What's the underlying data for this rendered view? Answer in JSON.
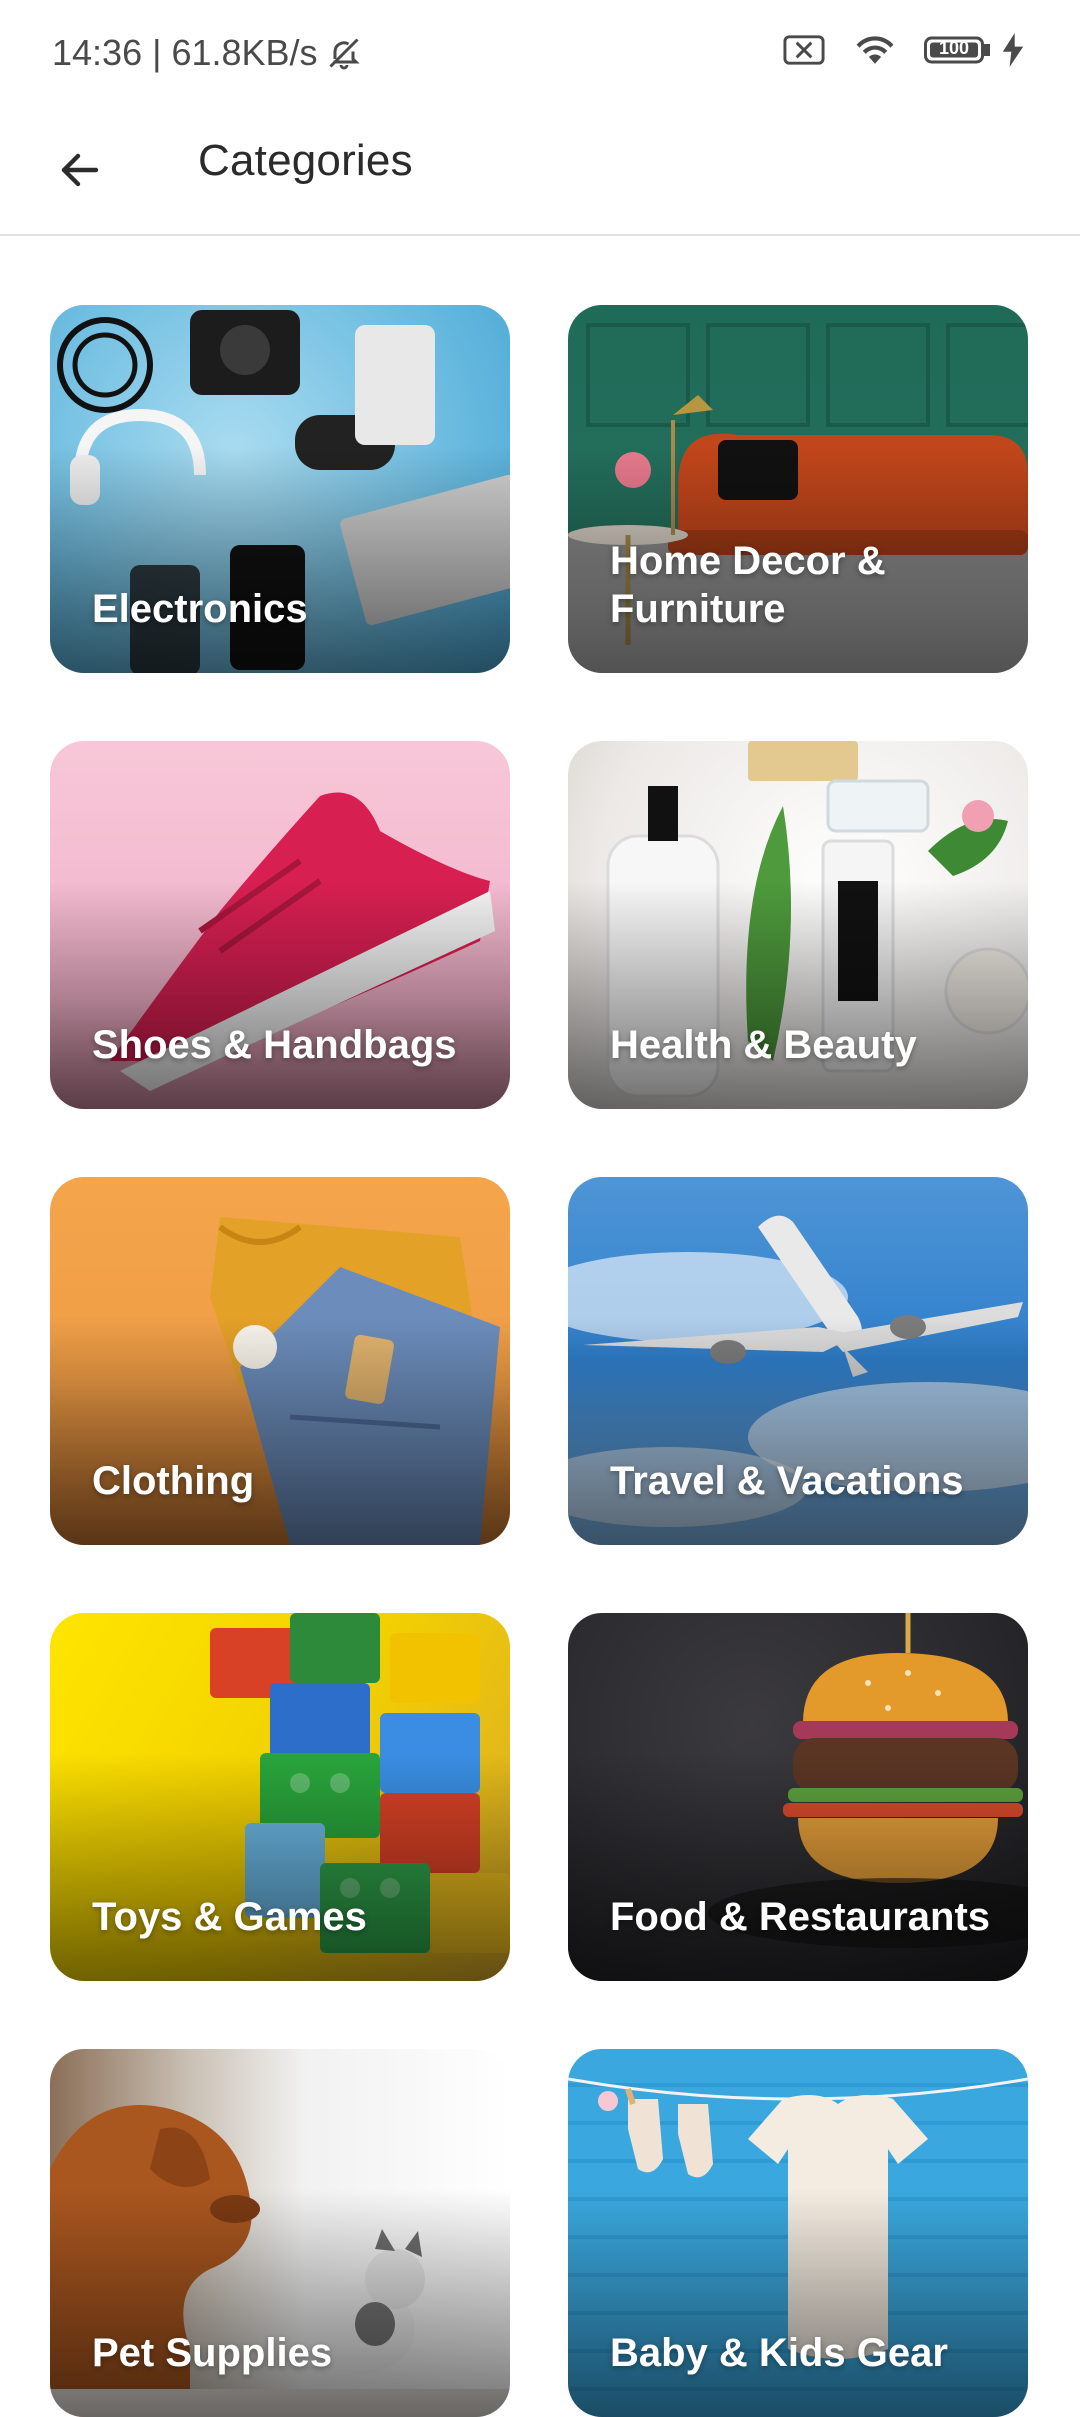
{
  "status_bar": {
    "time_speed": "14:36 | 61.8KB/s",
    "battery": "100",
    "icons": [
      "mute-icon",
      "sim-off-icon",
      "wifi-icon",
      "battery-icon",
      "charging-icon"
    ]
  },
  "header": {
    "title": "Categories",
    "back_icon": "arrow-left-icon"
  },
  "categories": [
    {
      "label": "Electronics"
    },
    {
      "label": "Home Decor & Furniture"
    },
    {
      "label": "Shoes & Handbags"
    },
    {
      "label": "Health & Beauty"
    },
    {
      "label": "Clothing"
    },
    {
      "label": "Travel & Vacations"
    },
    {
      "label": "Toys & Games"
    },
    {
      "label": "Food & Restaurants"
    },
    {
      "label": "Pet Supplies"
    },
    {
      "label": "Baby & Kids Gear"
    }
  ],
  "colors": {
    "title": "#2b2b2b",
    "divider": "#e1e1e1",
    "card_label": "#ffffff"
  }
}
